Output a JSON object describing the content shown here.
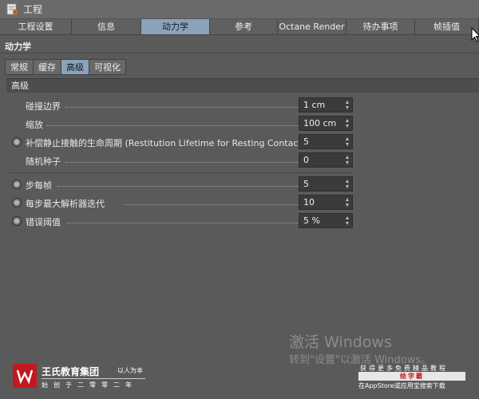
{
  "window": {
    "title": "工程"
  },
  "tabs": [
    {
      "label": "工程设置",
      "active": false
    },
    {
      "label": "信息",
      "active": false
    },
    {
      "label": "动力学",
      "active": true
    },
    {
      "label": "参考",
      "active": false
    },
    {
      "label": "Octane Render",
      "active": false
    },
    {
      "label": "待办事项",
      "active": false
    },
    {
      "label": "帧插值",
      "active": false
    }
  ],
  "panel": {
    "title": "动力学"
  },
  "subtabs": [
    {
      "label": "常规",
      "active": false
    },
    {
      "label": "缓存",
      "active": false
    },
    {
      "label": "高级",
      "active": true
    },
    {
      "label": "可视化",
      "active": false
    }
  ],
  "section": {
    "title": "高级"
  },
  "params_group1": [
    {
      "label": "碰撞边界",
      "value": "1 cm",
      "radio": false
    },
    {
      "label": "缩放",
      "value": "100 cm",
      "radio": false
    },
    {
      "label": "补偿静止接触的生命周期 (Restitution Lifetime for Resting Contact)",
      "value": "5",
      "radio": true
    },
    {
      "label": "随机种子",
      "value": "0",
      "radio": false
    }
  ],
  "params_group2": [
    {
      "label": "步每帧",
      "value": "5",
      "radio": true
    },
    {
      "label": "每步最大解析器迭代",
      "value": "10",
      "radio": true
    },
    {
      "label": "错误阈值",
      "value": "5 %",
      "radio": true
    }
  ],
  "watermark": {
    "line1": "激活 Windows",
    "line2": "转到\"设置\"以激活 Windows。"
  },
  "logo": {
    "name": "王氏教育集团",
    "slogan": "以人为本",
    "sub": "始创于二零零二年"
  },
  "badge": {
    "top": "获得更多免费精品教程",
    "mid": "绘学霸",
    "bot": "在AppStore或应用宝搜索下载"
  },
  "colors": {
    "background": "#5a5a5a",
    "active_tab": "#8aa3bd",
    "logo_red": "#c1191f"
  },
  "icons": {
    "app": "project-icon",
    "spinner": "spinner-arrows-icon",
    "cursor": "mouse-cursor-icon"
  }
}
